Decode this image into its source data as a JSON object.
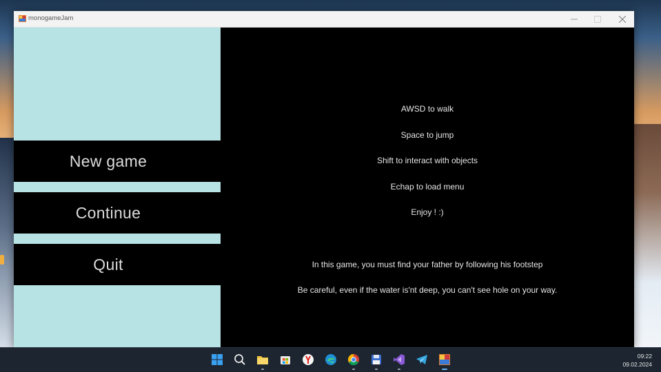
{
  "window": {
    "title": "monogameJam"
  },
  "menu": {
    "new_game": "New game",
    "continue": "Continue",
    "quit": "Quit"
  },
  "instructions": [
    "AWSD to walk",
    "Space to jump",
    "Shift to interact with objects",
    "Echap to load menu",
    "Enjoy ! :)"
  ],
  "story": [
    "In this game, you must find your father by following his footstep",
    "Be careful, even if the water is'nt deep, you can't see hole on your way."
  ],
  "colors": {
    "menu_panel": "#b8e3e5",
    "game_background": "#000000",
    "button_background": "#000000",
    "button_text": "#dcdcdc"
  },
  "taskbar": {
    "icons": [
      "windows-start-icon",
      "search-icon",
      "file-explorer-icon",
      "microsoft-store-icon",
      "yandex-browser-icon",
      "edge-icon",
      "chrome-icon",
      "save-disk-icon",
      "visual-studio-icon",
      "telegram-icon",
      "monogame-app-icon"
    ],
    "time": "09:22",
    "date": "09.02.2024"
  }
}
